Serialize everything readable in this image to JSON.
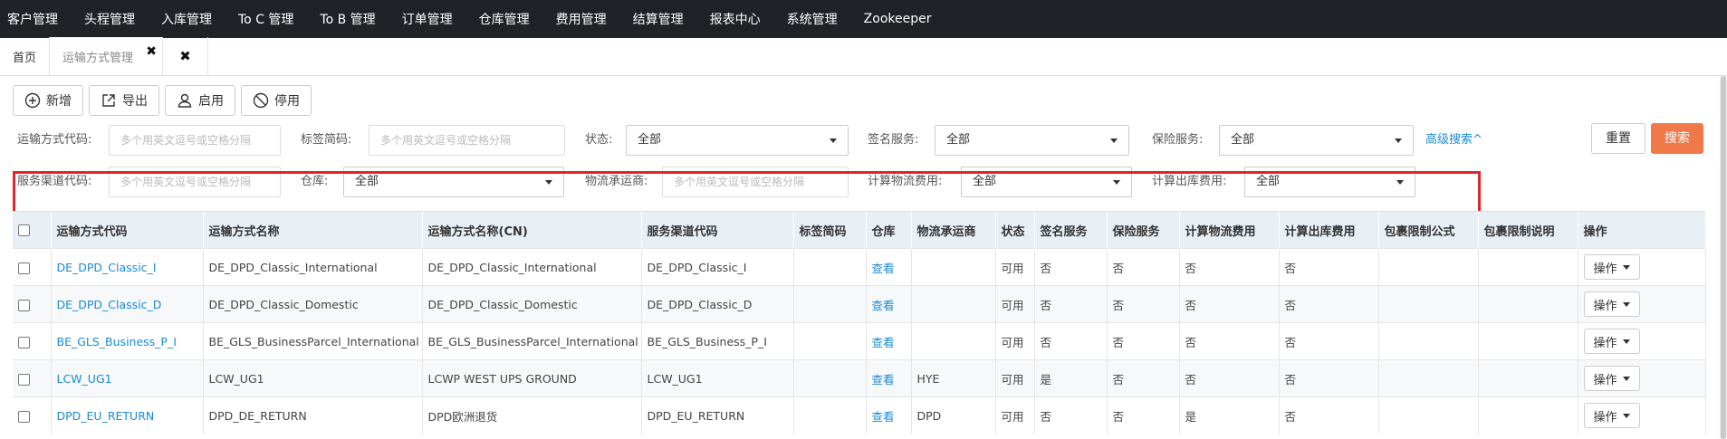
{
  "topnav": [
    "客户管理",
    "头程管理",
    "入库管理",
    "To C 管理",
    "To B 管理",
    "订单管理",
    "仓库管理",
    "费用管理",
    "结算管理",
    "报表中心",
    "系统管理",
    "Zookeeper"
  ],
  "tabs": {
    "home": "首页",
    "active": "运输方式管理",
    "close_glyph": "✖"
  },
  "toolbar": {
    "add": "新增",
    "export": "导出",
    "enable": "启用",
    "disable": "停用"
  },
  "filters": {
    "row1": {
      "code_label": "运输方式代码:",
      "code_placeholder": "多个用英文逗号或空格分隔",
      "tag_label": "标签简码:",
      "tag_placeholder": "多个用英文逗号或空格分隔",
      "status_label": "状态:",
      "status_value": "全部",
      "sign_label": "签名服务:",
      "sign_value": "全部",
      "insure_label": "保险服务:",
      "insure_value": "全部",
      "advanced": "高级搜索^"
    },
    "row2": {
      "channel_label": "服务渠道代码:",
      "channel_placeholder": "多个用英文逗号或空格分隔",
      "warehouse_label": "仓库:",
      "warehouse_value": "全部",
      "carrier_label": "物流承运商:",
      "carrier_placeholder": "多个用英文逗号或空格分隔",
      "logistic_fee_label": "计算物流费用:",
      "logistic_fee_value": "全部",
      "outbound_fee_label": "计算出库费用:",
      "outbound_fee_value": "全部"
    },
    "reset": "重置",
    "search": "搜索"
  },
  "table": {
    "headers": [
      "运输方式代码",
      "运输方式名称",
      "运输方式名称(CN)",
      "服务渠道代码",
      "标签简码",
      "仓库",
      "物流承运商",
      "状态",
      "签名服务",
      "保险服务",
      "计算物流费用",
      "计算出库费用",
      "包裹限制公式",
      "包裹限制说明",
      "操作"
    ],
    "view_label": "查看",
    "op_label": "操作",
    "rows": [
      [
        "DE_DPD_Classic_I",
        "DE_DPD_Classic_International",
        "DE_DPD_Classic_International",
        "DE_DPD_Classic_I",
        "",
        "",
        "可用",
        "否",
        "否",
        "否",
        "否",
        "",
        ""
      ],
      [
        "DE_DPD_Classic_D",
        "DE_DPD_Classic_Domestic",
        "DE_DPD_Classic_Domestic",
        "DE_DPD_Classic_D",
        "",
        "",
        "可用",
        "否",
        "否",
        "否",
        "否",
        "",
        ""
      ],
      [
        "BE_GLS_Business_P_I",
        "BE_GLS_BusinessParcel_International",
        "BE_GLS_BusinessParcel_International",
        "BE_GLS_Business_P_I",
        "",
        "",
        "可用",
        "否",
        "否",
        "否",
        "否",
        "",
        ""
      ],
      [
        "LCW_UG1",
        "LCW_UG1",
        "LCWP WEST UPS GROUND",
        "LCW_UG1",
        "",
        "HYE",
        "可用",
        "是",
        "否",
        "否",
        "否",
        "",
        ""
      ],
      [
        "DPD_EU_RETURN",
        "DPD_DE_RETURN",
        "DPD欧洲退货",
        "DPD_EU_RETURN",
        "",
        "DPD",
        "可用",
        "否",
        "否",
        "是",
        "否",
        "",
        ""
      ]
    ]
  }
}
